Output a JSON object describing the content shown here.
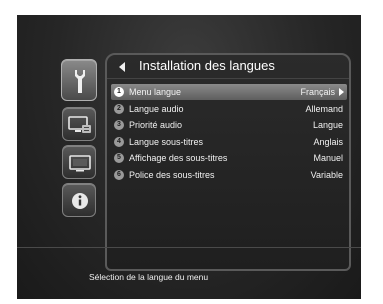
{
  "panel": {
    "title": "Installation des langues"
  },
  "side_icons": [
    {
      "name": "installation",
      "icon": "wrench-icon",
      "active": true
    },
    {
      "name": "system",
      "icon": "monitor-settings-icon",
      "active": false
    },
    {
      "name": "display",
      "icon": "tv-icon",
      "active": false
    },
    {
      "name": "info",
      "icon": "info-icon",
      "active": false
    }
  ],
  "menu": {
    "items": [
      {
        "number": "1",
        "label": "Menu langue",
        "value": "Français"
      },
      {
        "number": "2",
        "label": "Langue audio",
        "value": "Allemand"
      },
      {
        "number": "3",
        "label": "Priorité audio",
        "value": "Langue"
      },
      {
        "number": "4",
        "label": "Langue sous-titres",
        "value": "Anglais"
      },
      {
        "number": "5",
        "label": "Affichage des sous-titres",
        "value": "Manuel"
      },
      {
        "number": "6",
        "label": "Police des sous-titres",
        "value": "Variable"
      }
    ],
    "selected_index": 0
  },
  "hint": {
    "text": "Sélection de la langue du menu"
  }
}
